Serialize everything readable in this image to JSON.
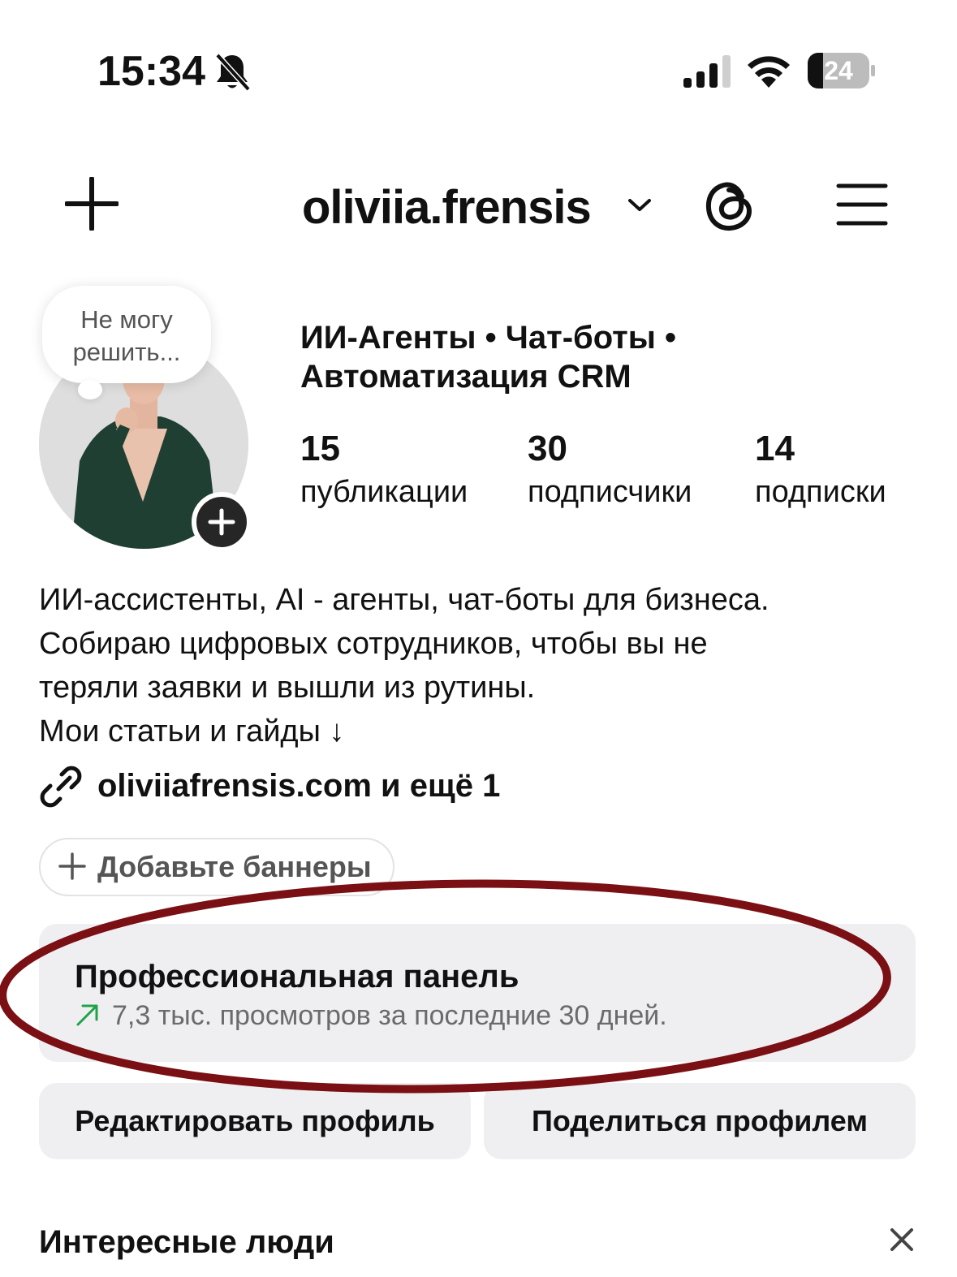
{
  "status_bar": {
    "time": "15:34",
    "battery": "24"
  },
  "header": {
    "username": "oliviia.frensis"
  },
  "avatar": {
    "thought_bubble": [
      "Не могу",
      "решить..."
    ]
  },
  "profile": {
    "category_lines": [
      "ИИ-Агенты • Чат-боты •",
      "Автоматизация CRM"
    ],
    "stats": [
      {
        "value": "15",
        "label": "публикации"
      },
      {
        "value": "30",
        "label": "подписчики"
      },
      {
        "value": "14",
        "label": "подписки"
      }
    ],
    "bio_lines": [
      "ИИ-ассистенты, AI - агенты, чат-боты для бизнеса.",
      "Собираю цифровых сотрудников, чтобы вы не",
      "теряли заявки и вышли из рутины.",
      "Мои статьи и гайды ↓"
    ],
    "link": "oliviiafrensis.com и ещё 1"
  },
  "banners": {
    "label": "Добавьте баннеры"
  },
  "pro_panel": {
    "title": "Профессиональная панель",
    "subtitle": "7,3 тыс. просмотров за последние 30 дней."
  },
  "actions": {
    "edit": "Редактировать профиль",
    "share": "Поделиться профилем"
  },
  "suggested": {
    "title": "Интересные люди"
  },
  "colors": {
    "annotation": "#7a0f14",
    "trend_up": "#1ea446",
    "panel_bg": "#efeff2"
  }
}
